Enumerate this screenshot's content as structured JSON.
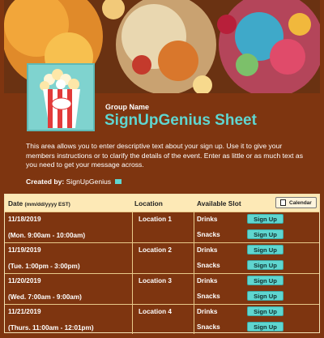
{
  "banner": {
    "description": ""
  },
  "group_name": "Group Name",
  "title": "SignUpGenius Sheet",
  "description": "This area allows you to enter descriptive text about your sign up. Use it to give your members instructions or to clarify the details of the event. Enter as little or as much text as you need to get your message across.",
  "created_by_label": "Created by:",
  "created_by_value": "SignUpGenius",
  "table": {
    "col_date": "Date",
    "col_date_format": "(mm/dd/yyyy EST)",
    "col_location": "Location",
    "col_slot": "Available Slot",
    "calendar_label": "Calendar",
    "rows": [
      {
        "date": "11/18/2019",
        "time": "(Mon. 9:00am - 10:00am)",
        "location": "Location 1",
        "slot1": "Drinks",
        "slot2": "Snacks"
      },
      {
        "date": "11/19/2019",
        "time": "(Tue. 1:00pm - 3:00pm)",
        "location": "Location 2",
        "slot1": "Drinks",
        "slot2": "Snacks"
      },
      {
        "date": "11/20/2019",
        "time": "(Wed. 7:00am - 9:00am)",
        "location": "Location 3",
        "slot1": "Drinks",
        "slot2": "Snacks"
      },
      {
        "date": "11/21/2019",
        "time": "(Thurs. 11:00am - 12:01pm)",
        "location": "Location 4",
        "slot1": "Drinks",
        "slot2": "Snacks"
      }
    ],
    "signup_label": "Sign Up"
  },
  "colors": {
    "background": "#7e3510",
    "accent": "#5fd6d0",
    "header_bg": "#fde9b6"
  },
  "icons": {
    "mail": "mail-icon",
    "calendar": "calendar-icon"
  }
}
